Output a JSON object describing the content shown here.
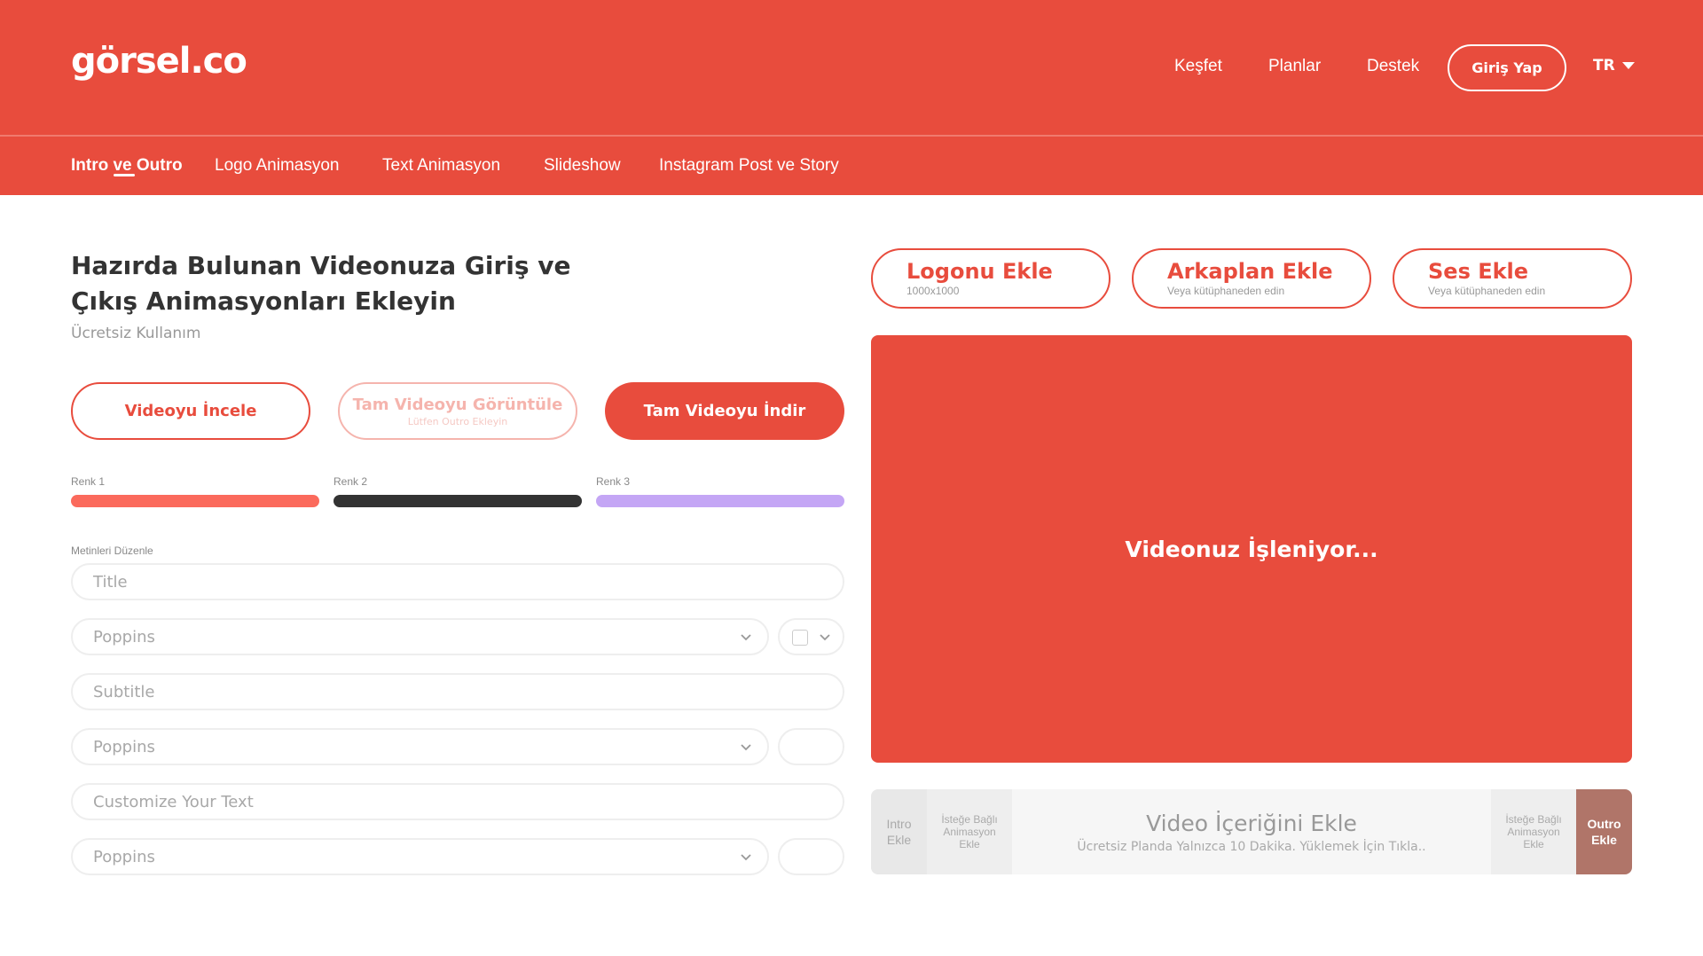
{
  "colors": {
    "brand": "#e84c3d",
    "swatch1": "#fb6a5c",
    "swatch2": "#333333",
    "swatch3": "#c4a6f5",
    "outro": "#b07569"
  },
  "header": {
    "logo": "görsel.co",
    "nav": [
      "Keşfet",
      "Planlar",
      "Destek"
    ],
    "login_label": "Giriş Yap",
    "lang": "TR"
  },
  "subnav": {
    "items": [
      "Intro ve Outro",
      "Logo Animasyon",
      "Text Animasyon",
      "Slideshow",
      "Instagram Post ve Story"
    ],
    "active_index": 0
  },
  "main": {
    "title": "Hazırda Bulunan Videonuza Giriş ve Çıkış Animasyonları Ekleyin",
    "subtitle": "Ücretsiz Kullanım",
    "buttons": {
      "preview": "Videoyu İncele",
      "full_view": "Tam Videoyu Görüntüle",
      "full_view_hint": "Lütfen Outro Ekleyin",
      "download": "Tam Videoyu İndir"
    },
    "colors": [
      {
        "label": "Renk 1",
        "value": "#fb6a5c"
      },
      {
        "label": "Renk 2",
        "value": "#333333"
      },
      {
        "label": "Renk 3",
        "value": "#c4a6f5"
      }
    ],
    "texts_label": "Metinleri Düzenle",
    "fields": [
      {
        "placeholder": "Title",
        "font": "Poppins"
      },
      {
        "placeholder": "Subtitle",
        "font": "Poppins"
      },
      {
        "placeholder": "Customize Your Text",
        "font": "Poppins"
      }
    ]
  },
  "assets": [
    {
      "title": "Logonu Ekle",
      "sub": "1000x1000"
    },
    {
      "title": "Arkaplan Ekle",
      "sub": "Veya kütüphaneden edin"
    },
    {
      "title": "Ses Ekle",
      "sub": "Veya kütüphaneden edin"
    }
  ],
  "preview": {
    "status": "Videonuz İşleniyor..."
  },
  "timeline": {
    "intro_line1": "Intro",
    "intro_line2": "Ekle",
    "optional_line1": "İsteğe Bağlı",
    "optional_line2": "Animasyon",
    "optional_line3": "Ekle",
    "main_title": "Video İçeriğini Ekle",
    "main_sub": "Ücretsiz Planda Yalnızca 10 Dakika. Yüklemek İçin Tıkla..",
    "outro_line1": "Outro",
    "outro_line2": "Ekle"
  },
  "icons": {
    "lang_caret": "caret-down-icon",
    "select_chevron": "chevron-down-icon",
    "checkbox": "checkbox-icon"
  }
}
